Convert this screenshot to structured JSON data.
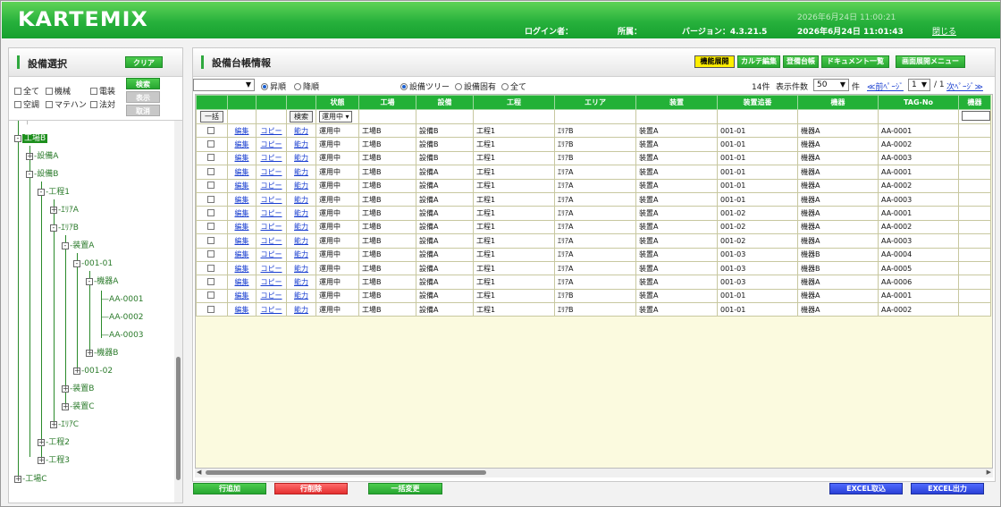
{
  "header": {
    "logo": "KARTEMIX",
    "datetime_top": "2026年6月24日 11:00:21",
    "login_label": "ログイン者：",
    "dept_label": "所属：",
    "version": "バージョン：4.3.21.5",
    "datetime": "2026年6月24日 11:01:43",
    "close": "閉じる"
  },
  "left": {
    "title": "設備選択",
    "clear": "クリア",
    "checkboxes": [
      "全て",
      "機械",
      "電装",
      "空調",
      "マテハン",
      "法対"
    ],
    "search": "検索",
    "show": "表示",
    "cancel": "取消",
    "tree": [
      {
        "label": "工場B",
        "toggle": "-",
        "selected": true
      },
      {
        "label": "設備A",
        "toggle": "+"
      },
      {
        "label": "設備B",
        "toggle": "-"
      },
      {
        "label": "工程1",
        "toggle": "-"
      },
      {
        "label": "ｴﾘｱA",
        "toggle": "+"
      },
      {
        "label": "ｴﾘｱB",
        "toggle": "-"
      },
      {
        "label": "装置A",
        "toggle": "-"
      },
      {
        "label": "001-01",
        "toggle": "-"
      },
      {
        "label": "機器A",
        "toggle": "-"
      },
      {
        "label": "AA-0001",
        "toggle": ""
      },
      {
        "label": "AA-0002",
        "toggle": ""
      },
      {
        "label": "AA-0003",
        "toggle": ""
      },
      {
        "label": "機器B",
        "toggle": "+"
      },
      {
        "label": "001-02",
        "toggle": "+"
      },
      {
        "label": "装置B",
        "toggle": "+"
      },
      {
        "label": "装置C",
        "toggle": "+"
      },
      {
        "label": "ｴﾘｱC",
        "toggle": "+"
      },
      {
        "label": "工程2",
        "toggle": "+"
      },
      {
        "label": "工程3",
        "toggle": "+"
      },
      {
        "label": "工場C",
        "toggle": "+"
      }
    ]
  },
  "right": {
    "title": "設備台帳情報",
    "toolbar": [
      "機能展開",
      "カルテ編集",
      "登備台帳",
      "ドキュメント一覧",
      "画面展開メニュー"
    ],
    "sort_asc": "昇順",
    "sort_desc": "降順",
    "view_tree": "設備ツリー",
    "view_unique": "設備固有",
    "view_all": "全て",
    "count": "14件",
    "per_page_label": "表示件数",
    "per_page": "50",
    "unit": "件",
    "prev": "≪前ﾍﾟｰｼﾞ",
    "page": "1",
    "page_total": "/ 1",
    "next": "次ﾍﾟｰｼﾞ≫",
    "columns": [
      "状態",
      "工場",
      "設備",
      "工程",
      "エリア",
      "装置",
      "装置追番",
      "機器",
      "TAG-No",
      "機器"
    ],
    "filter_bulk": "一括",
    "filter_search": "検索",
    "filter_status": "運用中",
    "link_edit": "編集",
    "link_copy": "コピー",
    "link_ability": "能力",
    "rows": [
      [
        "運用中",
        "工場B",
        "設備B",
        "工程1",
        "ｴﾘｱB",
        "装置A",
        "001-01",
        "機器A",
        "AA-0001"
      ],
      [
        "運用中",
        "工場B",
        "設備B",
        "工程1",
        "ｴﾘｱB",
        "装置A",
        "001-01",
        "機器A",
        "AA-0002"
      ],
      [
        "運用中",
        "工場B",
        "設備B",
        "工程1",
        "ｴﾘｱB",
        "装置A",
        "001-01",
        "機器A",
        "AA-0003"
      ],
      [
        "運用中",
        "工場B",
        "設備A",
        "工程1",
        "ｴﾘｱA",
        "装置A",
        "001-01",
        "機器A",
        "AA-0001"
      ],
      [
        "運用中",
        "工場B",
        "設備A",
        "工程1",
        "ｴﾘｱA",
        "装置A",
        "001-01",
        "機器A",
        "AA-0002"
      ],
      [
        "運用中",
        "工場B",
        "設備A",
        "工程1",
        "ｴﾘｱA",
        "装置A",
        "001-01",
        "機器A",
        "AA-0003"
      ],
      [
        "運用中",
        "工場B",
        "設備A",
        "工程1",
        "ｴﾘｱA",
        "装置A",
        "001-02",
        "機器A",
        "AA-0001"
      ],
      [
        "運用中",
        "工場B",
        "設備A",
        "工程1",
        "ｴﾘｱA",
        "装置A",
        "001-02",
        "機器A",
        "AA-0002"
      ],
      [
        "運用中",
        "工場B",
        "設備A",
        "工程1",
        "ｴﾘｱA",
        "装置A",
        "001-02",
        "機器A",
        "AA-0003"
      ],
      [
        "運用中",
        "工場B",
        "設備A",
        "工程1",
        "ｴﾘｱA",
        "装置A",
        "001-03",
        "機器B",
        "AA-0004"
      ],
      [
        "運用中",
        "工場B",
        "設備A",
        "工程1",
        "ｴﾘｱA",
        "装置A",
        "001-03",
        "機器B",
        "AA-0005"
      ],
      [
        "運用中",
        "工場B",
        "設備A",
        "工程1",
        "ｴﾘｱA",
        "装置A",
        "001-03",
        "機器A",
        "AA-0006"
      ],
      [
        "運用中",
        "工場B",
        "設備A",
        "工程1",
        "ｴﾘｱB",
        "装置A",
        "001-01",
        "機器A",
        "AA-0001"
      ],
      [
        "運用中",
        "工場B",
        "設備A",
        "工程1",
        "ｴﾘｱB",
        "装置A",
        "001-01",
        "機器A",
        "AA-0002"
      ]
    ]
  },
  "bottom": {
    "add_row": "行追加",
    "delete_row": "行削除",
    "bulk_change": "一括変更",
    "excel_import": "EXCEL取込",
    "excel_export": "EXCEL出力"
  }
}
